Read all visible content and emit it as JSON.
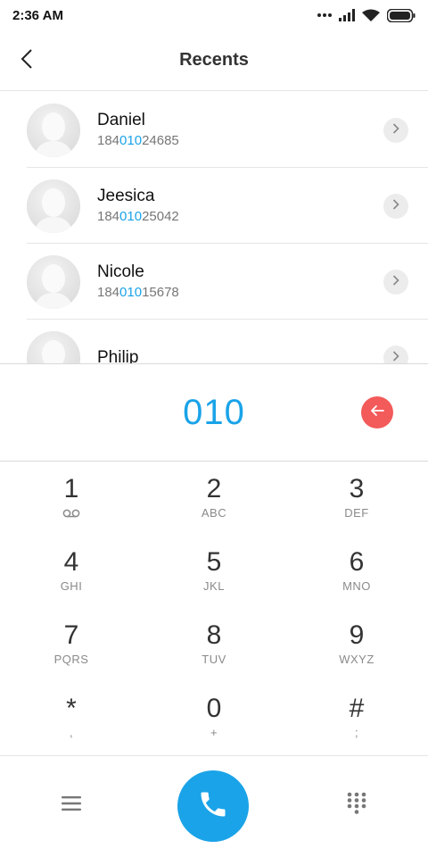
{
  "status_bar": {
    "time": "2:36 AM",
    "icons": [
      "more-dots-icon",
      "signal-icon",
      "wifi-icon",
      "battery-icon"
    ]
  },
  "header": {
    "title": "Recents",
    "back_icon": "chevron-left-icon"
  },
  "contacts": [
    {
      "name": "Daniel",
      "number_prefix": "184",
      "number_match": "010",
      "number_suffix": "24685"
    },
    {
      "name": "Jeesica",
      "number_prefix": "184",
      "number_match": "010",
      "number_suffix": "25042"
    },
    {
      "name": "Nicole",
      "number_prefix": "184",
      "number_match": "010",
      "number_suffix": "15678"
    },
    {
      "name": "Philip",
      "number_prefix": "",
      "number_match": "",
      "number_suffix": ""
    }
  ],
  "dial": {
    "number": "010",
    "backspace_icon": "backspace-arrow-icon"
  },
  "keypad": [
    {
      "digit": "1",
      "letters": "",
      "icon": "voicemail-icon"
    },
    {
      "digit": "2",
      "letters": "ABC"
    },
    {
      "digit": "3",
      "letters": "DEF"
    },
    {
      "digit": "4",
      "letters": "GHI"
    },
    {
      "digit": "5",
      "letters": "JKL"
    },
    {
      "digit": "6",
      "letters": "MNO"
    },
    {
      "digit": "7",
      "letters": "PQRS"
    },
    {
      "digit": "8",
      "letters": "TUV"
    },
    {
      "digit": "9",
      "letters": "WXYZ"
    },
    {
      "digit": "*",
      "letters": ","
    },
    {
      "digit": "0",
      "letters": "+"
    },
    {
      "digit": "#",
      "letters": ";"
    }
  ],
  "bottom_bar": {
    "menu_icon": "menu-icon",
    "call_icon": "phone-icon",
    "keypad_icon": "dialpad-icon"
  },
  "colors": {
    "accent": "#1aa3e8",
    "backspace": "#f35a5a"
  }
}
